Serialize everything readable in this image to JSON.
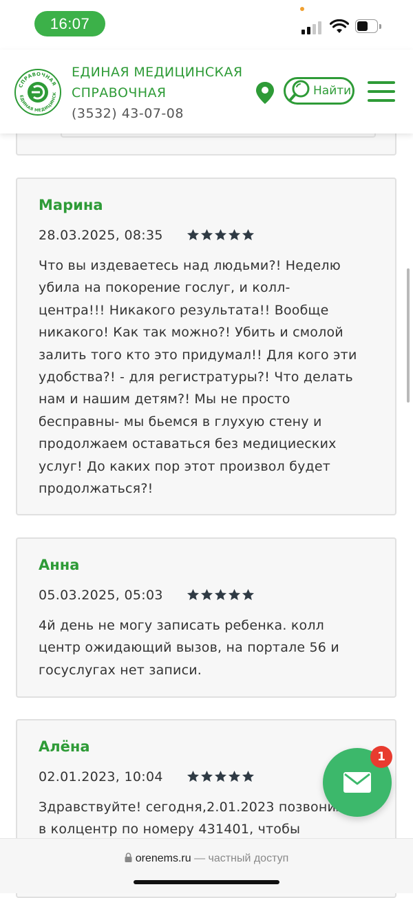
{
  "status_bar": {
    "time": "16:07"
  },
  "header": {
    "brand_line1": "ЕДИНАЯ МЕДИЦИНСКАЯ",
    "brand_line2": "СПРАВОЧНАЯ",
    "phone": "(3532) 43-07-08",
    "find_label": "Найти",
    "logo_text": "СПРАВОЧНАЯ ЕДИНАЯ МЕДИЦИНСКАЯ"
  },
  "reviews": [
    {
      "author": "Марина",
      "date": "28.03.2025, 08:35",
      "rating": 5,
      "lines": [
        "Что вы издеваетесь над людьми?! Неделю",
        "убила на покорение гослуг, и колл-",
        "центра!!! Никакого результата!! Вообще",
        "никакого! Как так можно?! Убить и смолой",
        "залить того кто это придумал!! Для кого эти",
        "удобства?! - для регистратуры?! Что делать",
        "нам и нашим детям?! Мы не просто",
        "бесправны- мы бьемся в глухую стену и",
        "продолжаем оставаться без медициеских",
        "услуг! До каких пор этот произвол будет",
        "продолжаться?!"
      ]
    },
    {
      "author": "Анна",
      "date": "05.03.2025, 05:03",
      "rating": 5,
      "lines": [
        "4й день не могу записать ребенка. колл",
        "центр ожидающий вызов, на портале 56 и",
        "госуслугах нет записи."
      ]
    },
    {
      "author": "Алёна",
      "date": "02.01.2023, 10:04",
      "rating": 5,
      "lines": [
        "Здравствуйте! сегодня,2.01.2023 позвонила",
        "в колцентр по номеру 431401, чтобы"
      ]
    }
  ],
  "fab": {
    "icon": "mail-icon",
    "badge_count": "1"
  },
  "url_bar": {
    "domain": "orenems.ru",
    "note": "— частный доступ"
  },
  "colors": {
    "brand_green": "#2e9b37",
    "fab_green": "#3cb86b",
    "badge_red": "#e83b2f",
    "star_dark": "#2f3a44"
  }
}
